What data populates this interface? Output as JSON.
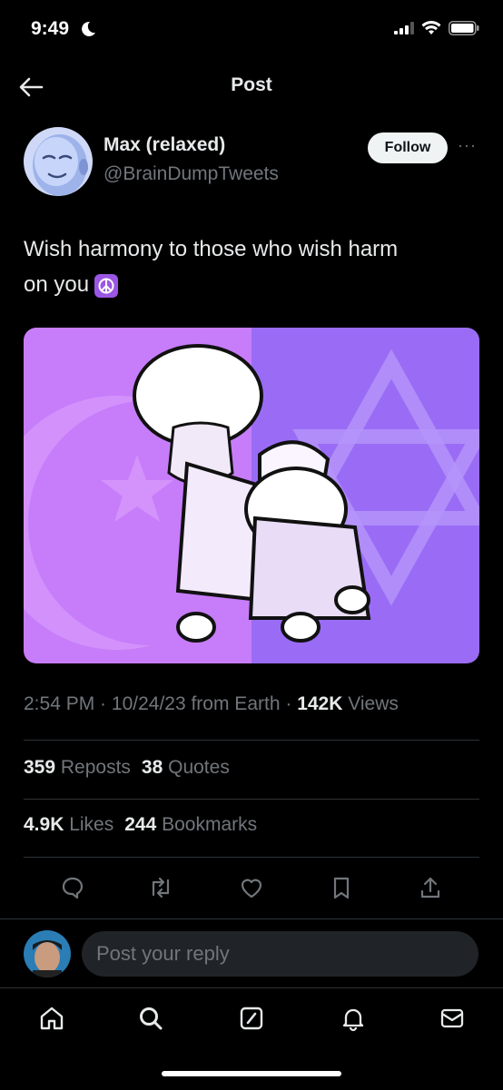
{
  "status_bar": {
    "time": "9:49"
  },
  "nav": {
    "title": "Post"
  },
  "post": {
    "author_name": "Max (relaxed)",
    "author_handle": "@BrainDumpTweets",
    "follow_label": "Follow",
    "more_label": "···",
    "text_line1": "Wish harmony to those who wish harm",
    "text_line2": "on you",
    "emoji": "peace-symbol-emoji",
    "time": "2:54 PM",
    "sep1": " · ",
    "date": "10/24/23",
    "source": " from Earth",
    "sep2": " · ",
    "views_count": "142K",
    "views_label": " Views"
  },
  "stats": {
    "reposts_count": "359",
    "reposts_label": " Reposts",
    "quotes_count": "38",
    "quotes_label": " Quotes",
    "likes_count": "4.9K",
    "likes_label": " Likes",
    "bookmarks_count": "244",
    "bookmarks_label": " Bookmarks"
  },
  "actions": [
    "reply-icon",
    "repost-icon",
    "like-icon",
    "bookmark-icon",
    "share-icon"
  ],
  "reply": {
    "placeholder": "Post your reply"
  },
  "tabs": [
    "home-icon",
    "search-icon",
    "grok-icon",
    "notifications-icon",
    "messages-icon"
  ],
  "colors": {
    "background": "#000000",
    "text_primary": "#e7e9ea",
    "text_secondary": "#71767b",
    "divider": "#2f3336",
    "media_left": "#c77dfa",
    "media_right": "#9a6cf6"
  }
}
